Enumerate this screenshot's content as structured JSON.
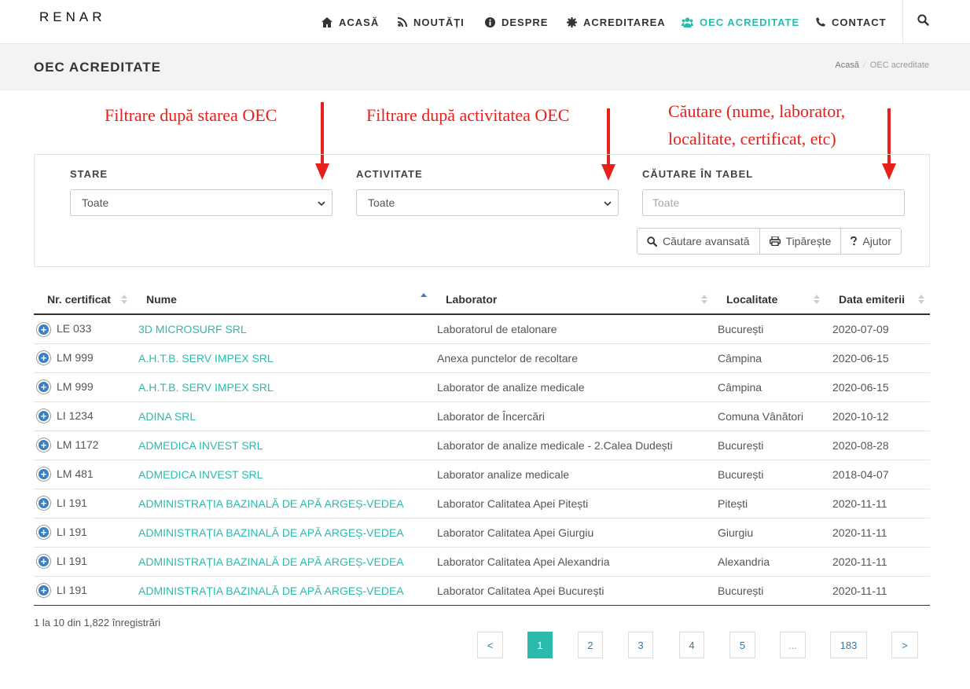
{
  "nav": {
    "logo": "RENAR",
    "items": [
      {
        "label": "ACASĂ",
        "icon": "home-icon"
      },
      {
        "label": "NOUTĂȚI",
        "icon": "rss-icon"
      },
      {
        "label": "DESPRE",
        "icon": "info-icon"
      },
      {
        "label": "ACREDITAREA",
        "icon": "gear-icon"
      },
      {
        "label": "OEC ACREDITATE",
        "icon": "users-icon",
        "active": true
      },
      {
        "label": "CONTACT",
        "icon": "phone-icon"
      }
    ]
  },
  "page": {
    "title": "OEC ACREDITATE",
    "breadcrumb": {
      "home": "Acasă",
      "separator": "⁄",
      "current": "OEC acreditate"
    }
  },
  "annotations": {
    "stare": "Filtrare după starea OEC",
    "activitate": "Filtrare după activitatea OEC",
    "cautare_line1": "Căutare (nume, laborator,",
    "cautare_line2": "localitate, certificat, etc)"
  },
  "filters": {
    "stare_label": "STARE",
    "stare_value": "Toate",
    "activitate_label": "ACTIVITATE",
    "activitate_value": "Toate",
    "cautare_label": "CĂUTARE ÎN TABEL",
    "cautare_placeholder": "Toate",
    "buttons": {
      "advanced": "Căutare avansată",
      "print": "Tipărește",
      "help": "Ajutor"
    }
  },
  "table": {
    "headers": [
      "Nr. certificat",
      "Nume",
      "Laborator",
      "Localitate",
      "Data emiterii"
    ],
    "rows": [
      {
        "cert": "LE 033",
        "name": "3D MICROSURF SRL",
        "lab": "Laboratorul de etalonare",
        "loc": "București",
        "date": "2020-07-09"
      },
      {
        "cert": "LM 999",
        "name": "A.H.T.B. SERV IMPEX SRL",
        "lab": "Anexa punctelor de recoltare",
        "loc": "Câmpina",
        "date": "2020-06-15"
      },
      {
        "cert": "LM 999",
        "name": "A.H.T.B. SERV IMPEX SRL",
        "lab": "Laborator de analize medicale",
        "loc": "Câmpina",
        "date": "2020-06-15"
      },
      {
        "cert": "LI 1234",
        "name": "ADINA SRL",
        "lab": "Laborator de Încercări",
        "loc": "Comuna Vânători",
        "date": "2020-10-12"
      },
      {
        "cert": "LM 1172",
        "name": "ADMEDICA INVEST SRL",
        "lab": "Laborator de analize medicale - 2.Calea Dudești",
        "loc": "București",
        "date": "2020-08-28"
      },
      {
        "cert": "LM 481",
        "name": "ADMEDICA INVEST SRL",
        "lab": "Laborator analize medicale",
        "loc": "București",
        "date": "2018-04-07"
      },
      {
        "cert": "LI 191",
        "name": "ADMINISTRAȚIA BAZINALĂ DE APĂ ARGEȘ-VEDEA",
        "lab": "Laborator Calitatea Apei Pitești",
        "loc": "Pitești",
        "date": "2020-11-11"
      },
      {
        "cert": "LI 191",
        "name": "ADMINISTRAȚIA BAZINALĂ DE APĂ ARGEȘ-VEDEA",
        "lab": "Laborator Calitatea Apei Giurgiu",
        "loc": "Giurgiu",
        "date": "2020-11-11"
      },
      {
        "cert": "LI 191",
        "name": "ADMINISTRAȚIA BAZINALĂ DE APĂ ARGEȘ-VEDEA",
        "lab": "Laborator Calitatea Apei Alexandria",
        "loc": "Alexandria",
        "date": "2020-11-11"
      },
      {
        "cert": "LI 191",
        "name": "ADMINISTRAȚIA BAZINALĂ DE APĂ ARGEȘ-VEDEA",
        "lab": "Laborator Calitatea Apei București",
        "loc": "București",
        "date": "2020-11-11"
      }
    ],
    "info": "1 la 10 din 1,822 înregistrări"
  },
  "pagination": {
    "prev": "<",
    "pages": [
      "1",
      "2",
      "3",
      "4",
      "5",
      "...",
      "183"
    ],
    "current": "1",
    "next": ">"
  },
  "colors": {
    "accent": "#2bbbad",
    "annotation": "#e8201c",
    "plus_icon": "#3a7fc1"
  }
}
